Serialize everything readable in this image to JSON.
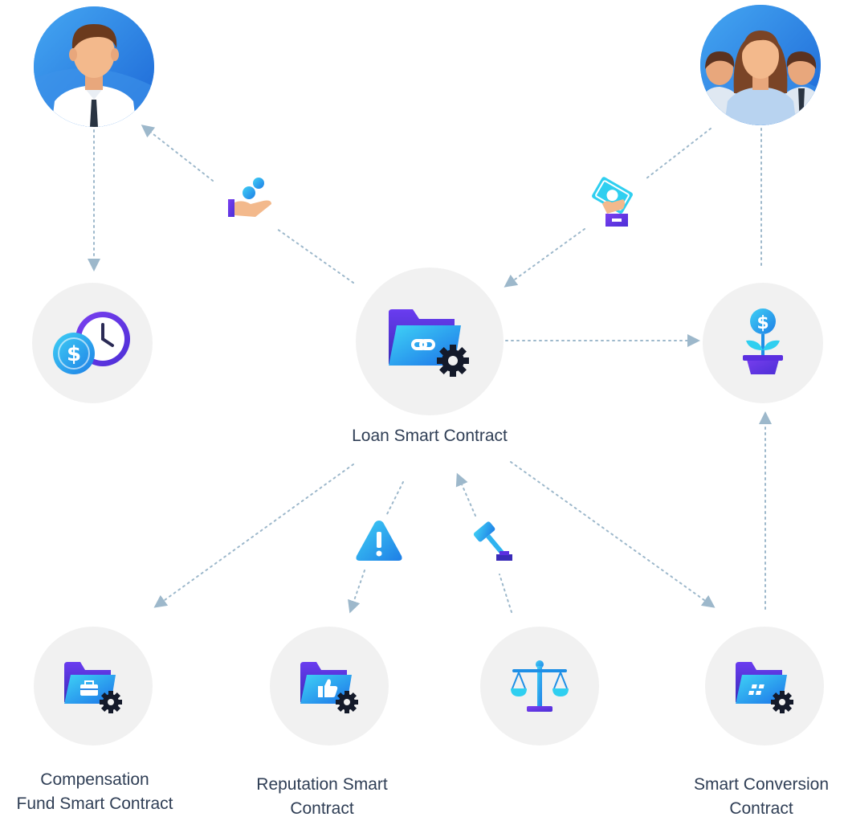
{
  "diagram": {
    "nodes": {
      "borrower": {
        "icon": "businessman-avatar-icon"
      },
      "lenders": {
        "icon": "group-avatar-icon"
      },
      "repayment_schedule": {
        "icon": "dollar-clock-icon"
      },
      "loan_contract": {
        "label": "Loan Smart Contract",
        "icon": "folder-link-gear-icon"
      },
      "investment": {
        "icon": "dollar-plant-icon"
      },
      "compensation_fund": {
        "label_line1": "Compensation",
        "label_line2": "Fund Smart Contract",
        "icon": "folder-briefcase-gear-icon"
      },
      "reputation": {
        "label_line1": "Reputation Smart",
        "label_line2": "Contract",
        "icon": "folder-thumbs-up-gear-icon"
      },
      "arbitration": {
        "icon": "scales-icon"
      },
      "conversion": {
        "label_line1": "Smart Conversion",
        "label_line2": "Contract",
        "icon": "folder-grid-gear-icon"
      }
    },
    "edge_icons": {
      "loan_payout": "hand-coins-icon",
      "funding": "hand-cash-icon",
      "warning": "warning-icon",
      "judgement": "gavel-icon"
    },
    "colors": {
      "node_fill": "#f1f1f1",
      "connector": "#9db8cb",
      "icon_blue": "#1f8fe8",
      "icon_cyan": "#2fcff0",
      "icon_indigo": "#5b2fe0",
      "label_text": "#2f3e55"
    }
  }
}
